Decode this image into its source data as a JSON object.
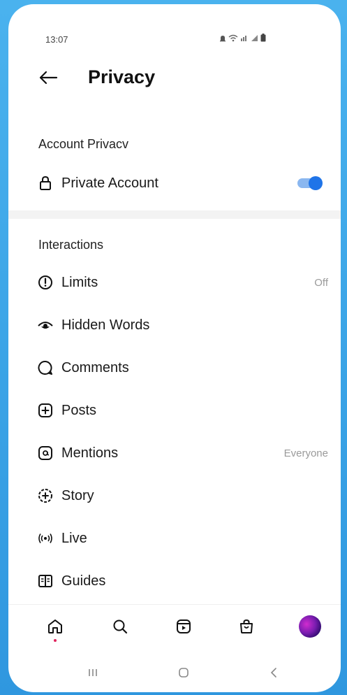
{
  "status_bar": {
    "time": "13:07"
  },
  "header": {
    "title": "Privacy"
  },
  "account_privacy": {
    "heading": "Account Privacv",
    "private_account": {
      "label": "Private Account",
      "enabled": true
    }
  },
  "interactions": {
    "heading": "Interactions",
    "items": [
      {
        "label": "Limits",
        "value": "Off",
        "icon": "limits-icon"
      },
      {
        "label": "Hidden Words",
        "value": "",
        "icon": "eye-icon"
      },
      {
        "label": "Comments",
        "value": "",
        "icon": "comment-icon"
      },
      {
        "label": "Posts",
        "value": "",
        "icon": "plus-square-icon"
      },
      {
        "label": "Mentions",
        "value": "Everyone",
        "icon": "at-icon"
      },
      {
        "label": "Story",
        "value": "",
        "icon": "story-icon"
      },
      {
        "label": "Live",
        "value": "",
        "icon": "live-icon"
      },
      {
        "label": "Guides",
        "value": "",
        "icon": "guides-icon"
      }
    ]
  },
  "tab_bar": {
    "items": [
      "home-icon",
      "search-icon",
      "reels-icon",
      "shop-icon",
      "profile-avatar"
    ]
  },
  "colors": {
    "background_blue": "#3aa3e6",
    "toggle_on": "#1f74e8",
    "notification_dot": "#e0245e"
  }
}
